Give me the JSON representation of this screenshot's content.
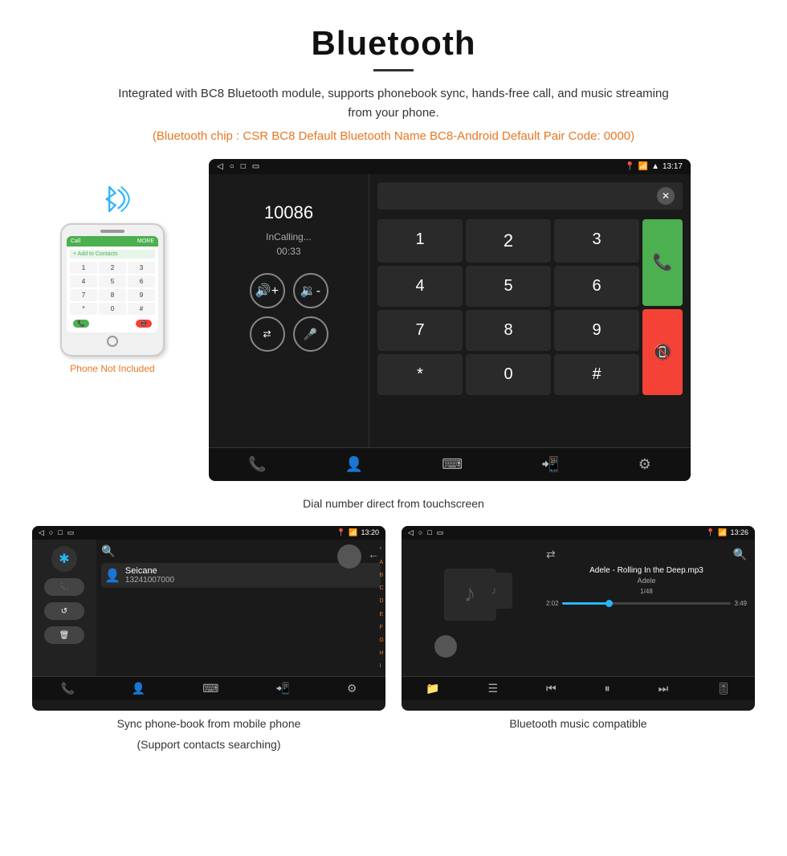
{
  "page": {
    "title": "Bluetooth",
    "description": "Integrated with BC8 Bluetooth module, supports phonebook sync, hands-free call, and music streaming from your phone.",
    "orange_info": "(Bluetooth chip : CSR BC8    Default Bluetooth Name BC8-Android    Default Pair Code: 0000)",
    "phone_not_included": "Phone Not Included",
    "dial_caption": "Dial number direct from touchscreen",
    "phonebook_caption_line1": "Sync phone-book from mobile phone",
    "phonebook_caption_line2": "(Support contacts searching)",
    "music_caption": "Bluetooth music compatible"
  },
  "dial_screen": {
    "status_time": "13:17",
    "number": "10086",
    "call_status": "InCalling...",
    "timer": "00:33",
    "numpad": [
      "1",
      "2",
      "3",
      "*",
      "4",
      "5",
      "6",
      "0",
      "7",
      "8",
      "9",
      "#"
    ]
  },
  "phonebook_screen": {
    "status_time": "13:20",
    "contact_name": "Seicane",
    "contact_number": "13241007000",
    "alphabet": [
      "A",
      "B",
      "C",
      "D",
      "E",
      "F",
      "G",
      "H",
      "I"
    ]
  },
  "music_screen": {
    "status_time": "13:26",
    "track_name": "Adele - Rolling In the Deep.mp3",
    "artist": "Adele",
    "track_count": "1/48",
    "time_current": "2:02",
    "time_total": "3:49",
    "progress_percent": 33
  }
}
